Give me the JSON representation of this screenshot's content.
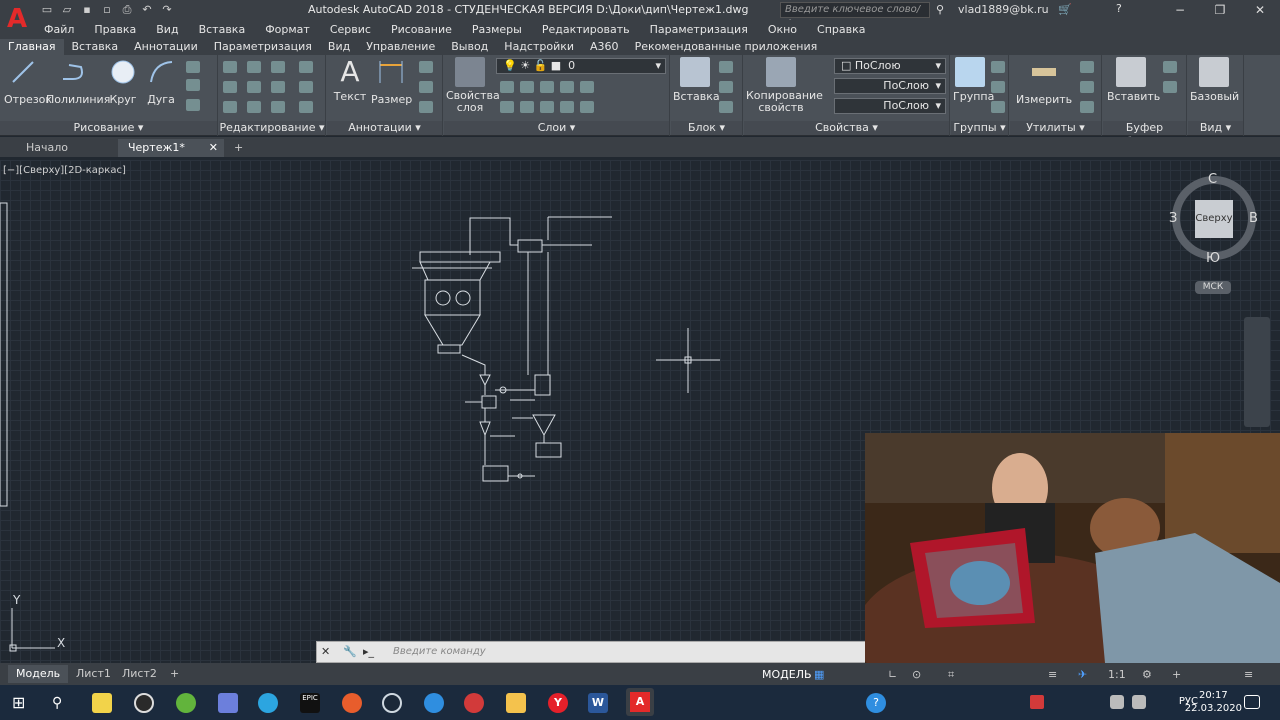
{
  "app": {
    "title": "Autodesk AutoCAD 2018 - СТУДЕНЧЕСКАЯ ВЕРСИЯ    D:\\Доки\\дип\\Чертеж1.dwg",
    "search_placeholder": "Введите ключевое слово/фразу",
    "user": "vlad1889@bk.ru",
    "logo": "A"
  },
  "menu": [
    "Файл",
    "Правка",
    "Вид",
    "Вставка",
    "Формат",
    "Сервис",
    "Рисование",
    "Размеры",
    "Редактировать",
    "Параметризация",
    "Окно",
    "Справка"
  ],
  "ribbon_tabs": [
    "Главная",
    "Вставка",
    "Аннотации",
    "Параметризация",
    "Вид",
    "Управление",
    "Вывод",
    "Надстройки",
    "A360",
    "Рекомендованные приложения"
  ],
  "ribbon": {
    "draw": {
      "title": "Рисование",
      "tools": [
        "Отрезок",
        "Полилиния",
        "Круг",
        "Дуга"
      ]
    },
    "modify": {
      "title": "Редактирование"
    },
    "annotation": {
      "title": "Аннотации",
      "tools": [
        "Текст",
        "Размер"
      ]
    },
    "layers": {
      "title": "Слои",
      "tool": "Свойства слоя",
      "layer_value": "0"
    },
    "block": {
      "title": "Блок",
      "tool": "Вставка"
    },
    "properties": {
      "title": "Свойства",
      "tool": "Копирование свойств",
      "color": "ПоСлою",
      "linetype": "ПоСлою",
      "lineweight": "ПоСлою"
    },
    "groups": {
      "title": "Группы",
      "tool": "Группа"
    },
    "utilities": {
      "title": "Утилиты",
      "tool": "Измерить"
    },
    "clipboard": {
      "title": "Буфер обмена",
      "tool": "Вставить"
    },
    "view": {
      "title": "Вид",
      "tool": "Базовый"
    }
  },
  "doc_tabs": [
    "Начало",
    "Чертеж1*"
  ],
  "viewport": {
    "label": "[−][Сверху][2D-каркас]",
    "viewcube": {
      "n": "С",
      "s": "Ю",
      "w": "З",
      "e": "В",
      "face": "Сверху",
      "ucs": "МСК"
    },
    "ucs_x": "X",
    "ucs_y": "Y"
  },
  "command": {
    "placeholder": "Введите команду"
  },
  "layout_tabs": [
    "Модель",
    "Лист1",
    "Лист2"
  ],
  "status": {
    "model": "МОДЕЛЬ",
    "scale": "1:1"
  },
  "taskbar": {
    "lang": "РУС",
    "time": "20:17",
    "date": "22.03.2020"
  },
  "colors": {
    "canvas": "#212830",
    "autocad_red": "#e32a2a",
    "ribbon": "#4b5158"
  }
}
